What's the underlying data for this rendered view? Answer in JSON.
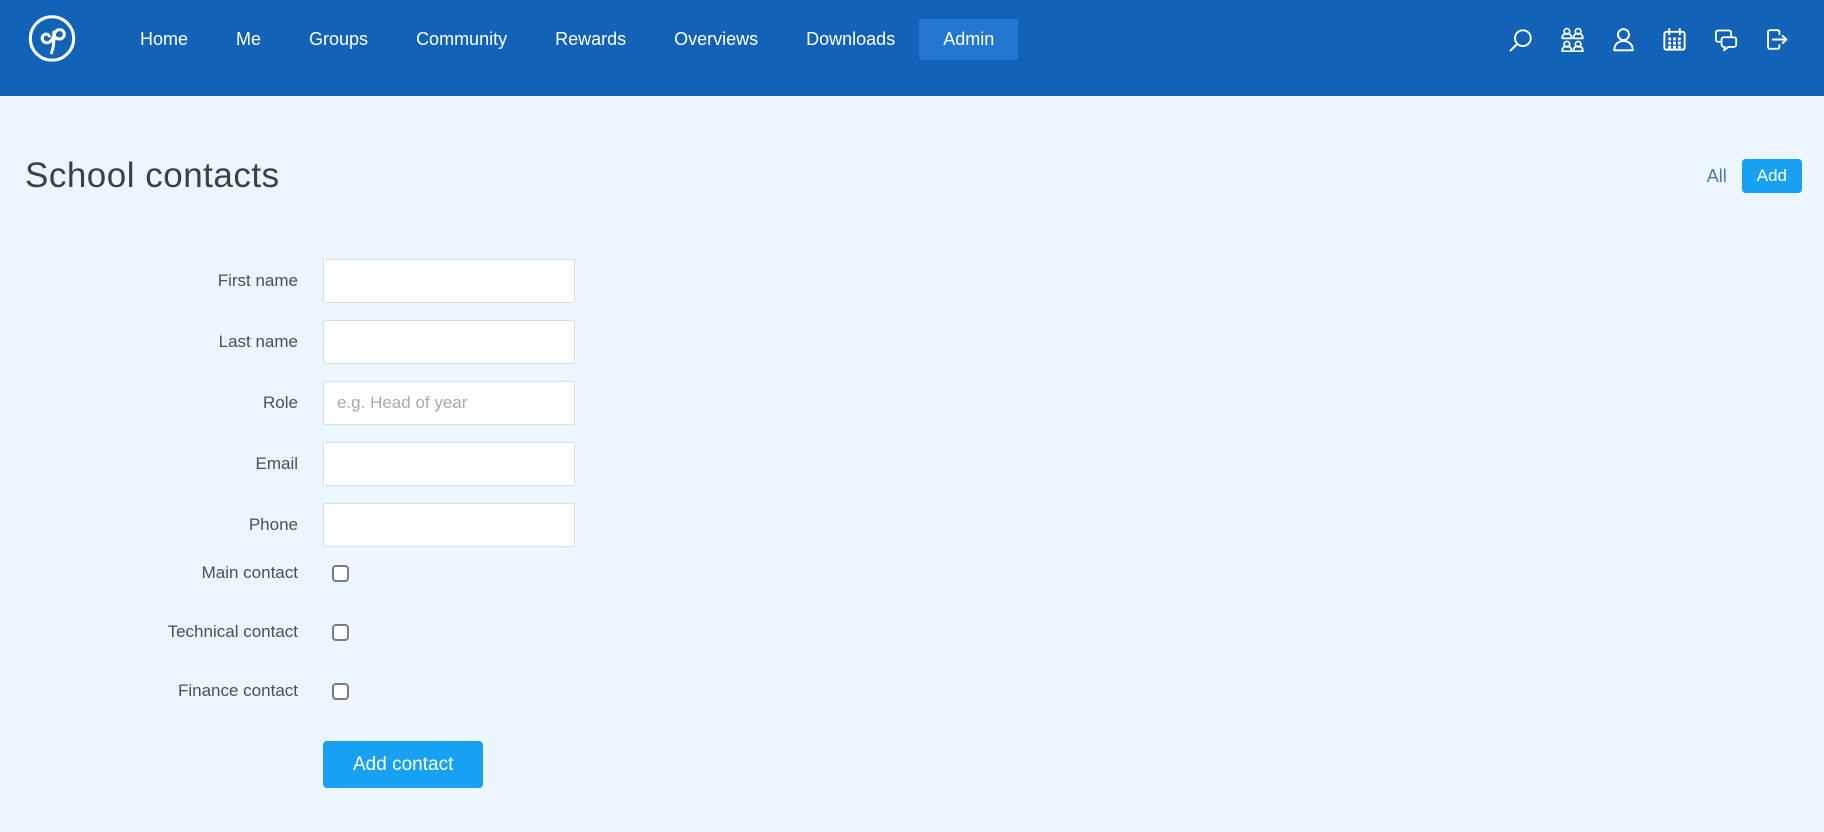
{
  "nav": {
    "items": [
      {
        "label": "Home",
        "active": false
      },
      {
        "label": "Me",
        "active": false
      },
      {
        "label": "Groups",
        "active": false
      },
      {
        "label": "Community",
        "active": false
      },
      {
        "label": "Rewards",
        "active": false
      },
      {
        "label": "Overviews",
        "active": false
      },
      {
        "label": "Downloads",
        "active": false
      },
      {
        "label": "Admin",
        "active": true
      }
    ],
    "icons": [
      {
        "name": "search-icon"
      },
      {
        "name": "community-icon"
      },
      {
        "name": "profile-icon"
      },
      {
        "name": "timetable-icon"
      },
      {
        "name": "messages-icon"
      },
      {
        "name": "logout-icon"
      }
    ]
  },
  "page": {
    "title": "School contacts"
  },
  "header_actions": {
    "all_label": "All",
    "add_label": "Add"
  },
  "form": {
    "fields": [
      {
        "label": "First name",
        "value": "",
        "placeholder": ""
      },
      {
        "label": "Last name",
        "value": "",
        "placeholder": ""
      },
      {
        "label": "Role",
        "value": "",
        "placeholder": "e.g. Head of year"
      },
      {
        "label": "Email",
        "value": "",
        "placeholder": ""
      },
      {
        "label": "Phone",
        "value": "",
        "placeholder": ""
      }
    ],
    "checkboxes": [
      {
        "label": "Main contact",
        "checked": false
      },
      {
        "label": "Technical contact",
        "checked": false
      },
      {
        "label": "Finance contact",
        "checked": false
      }
    ],
    "submit_label": "Add contact"
  },
  "colors": {
    "navbar": "#1263b8",
    "nav_active_bg": "#2477d0",
    "accent_button": "#18a0f3",
    "page_background": "#edf5fd",
    "all_link": "#4b79b8"
  }
}
